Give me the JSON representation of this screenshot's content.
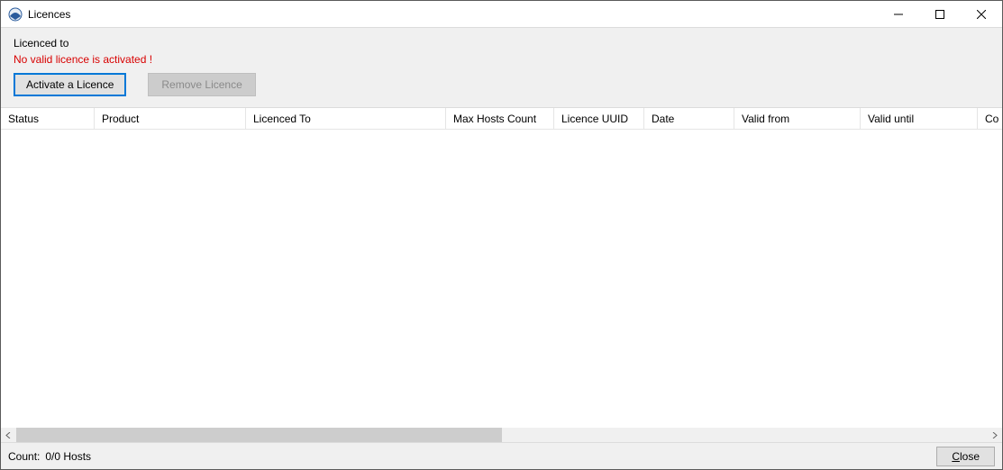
{
  "window": {
    "title": "Licences"
  },
  "top": {
    "licenced_to_label": "Licenced to",
    "status_message": "No valid licence is activated !",
    "activate_label": "Activate a Licence",
    "remove_label": "Remove Licence"
  },
  "table": {
    "columns": {
      "status": "Status",
      "product": "Product",
      "licenced_to": "Licenced To",
      "max_hosts": "Max Hosts Count",
      "licence_uuid": "Licence UUID",
      "date": "Date",
      "valid_from": "Valid from",
      "valid_until": "Valid until",
      "co": "Co"
    },
    "rows": []
  },
  "footer": {
    "count_label": "Count:",
    "count_value": "0/0 Hosts",
    "close_prefix": "C",
    "close_rest": "lose"
  }
}
